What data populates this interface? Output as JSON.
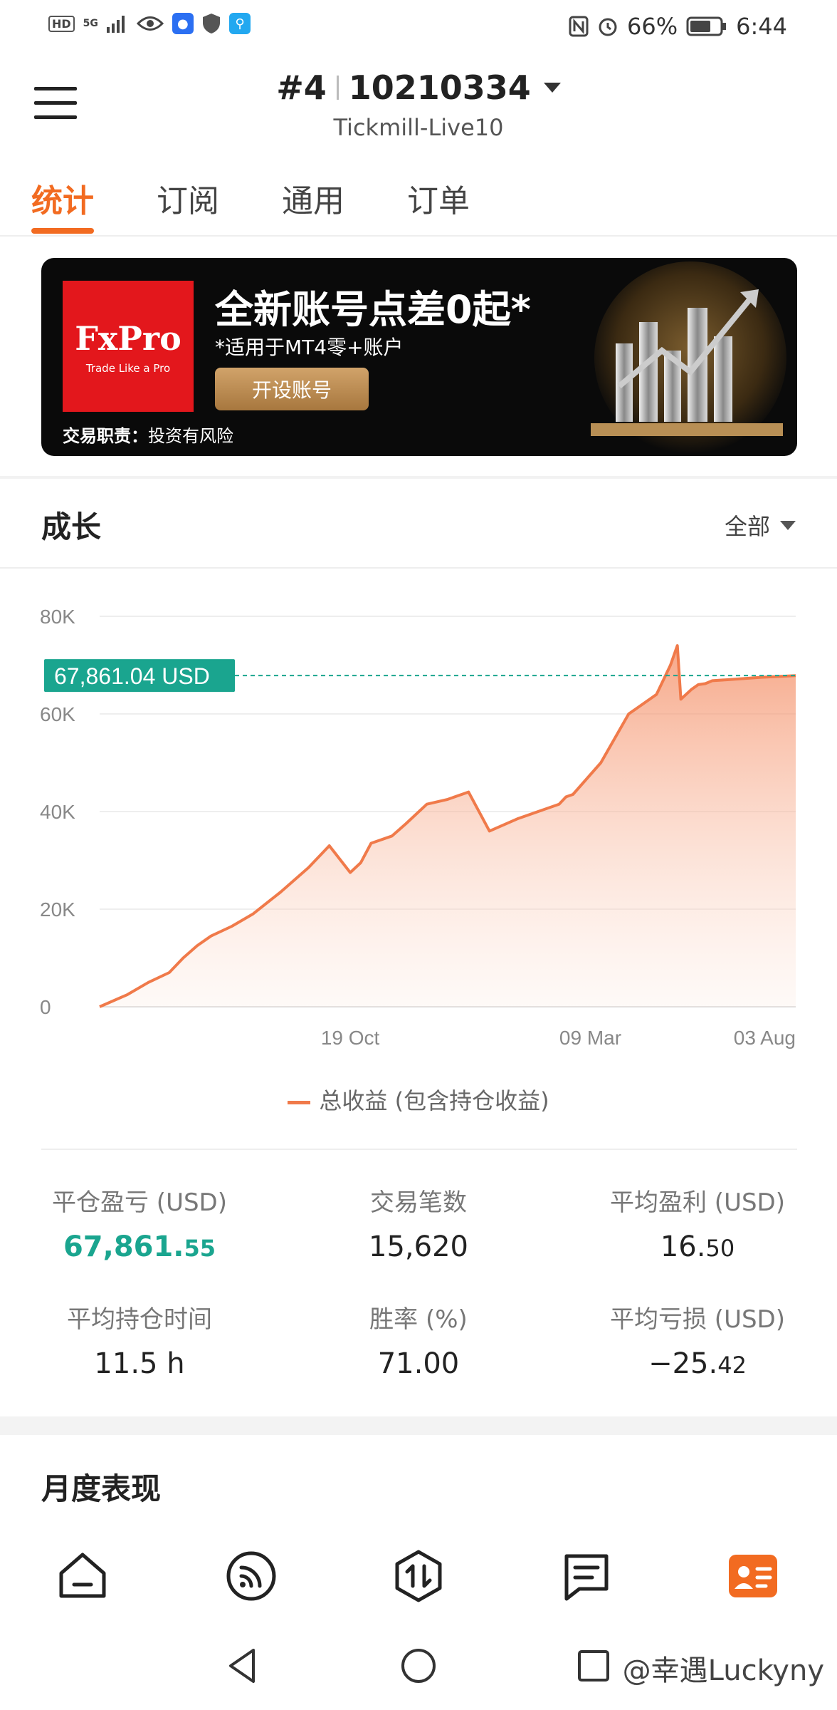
{
  "status_bar": {
    "hd": "HD",
    "net": "5G",
    "battery": "66%",
    "time": "6:44"
  },
  "header": {
    "account_index": "#4",
    "account_number": "10210334",
    "server": "Tickmill-Live10"
  },
  "tabs": [
    {
      "label": "统计",
      "active": true
    },
    {
      "label": "订阅",
      "active": false
    },
    {
      "label": "通用",
      "active": false
    },
    {
      "label": "订单",
      "active": false
    }
  ],
  "banner": {
    "logo": "FxPro",
    "logo_tagline": "Trade Like a Pro",
    "title": "全新账号点差0起*",
    "subtitle": "*适用于MT4零+账户",
    "button": "开设账号",
    "risk_label": "交易职责：",
    "risk_text": "投资有风险"
  },
  "growth": {
    "title": "成长",
    "range": "全部",
    "current_value_tag": "67,861.04 USD",
    "legend": "总收益 (包含持仓收益)"
  },
  "chart_data": {
    "type": "area",
    "title": "",
    "xlabel": "",
    "ylabel": "",
    "ylim": [
      0,
      80000
    ],
    "y_ticks": [
      "0",
      "20K",
      "40K",
      "60K",
      "80K"
    ],
    "x_ticks": [
      "19 Oct",
      "09 Mar",
      "03 Aug"
    ],
    "line_color": "#f07a4a",
    "reference_color": "#1aa58f",
    "reference_value": 67861.04,
    "series": [
      {
        "x": [
          0,
          0.04,
          0.07,
          0.1,
          0.12,
          0.14,
          0.16,
          0.19,
          0.22,
          0.26,
          0.3,
          0.33,
          0.36,
          0.375,
          0.39,
          0.42,
          0.44,
          0.47,
          0.5,
          0.53,
          0.56,
          0.6,
          0.63,
          0.66,
          0.67,
          0.68,
          0.72,
          0.76,
          0.8,
          0.82,
          0.83,
          0.835,
          0.85,
          0.86,
          0.87,
          0.875,
          0.88,
          0.9,
          0.95,
          1.0
        ],
        "values": [
          0,
          2500,
          5000,
          7000,
          10000,
          12500,
          14500,
          16500,
          19000,
          23500,
          28500,
          33000,
          27500,
          29500,
          33500,
          35000,
          37500,
          41500,
          42500,
          44000,
          36000,
          38500,
          40000,
          41500,
          43000,
          43500,
          50000,
          60000,
          64000,
          70000,
          74000,
          63000,
          65000,
          66000,
          66200,
          66500,
          66800,
          67000,
          67500,
          67861.04
        ]
      }
    ]
  },
  "stats": [
    {
      "label": "平仓盈亏 (USD)",
      "int": "67,861.",
      "dec": "55",
      "green": true
    },
    {
      "label": "交易笔数",
      "int": "15,620",
      "dec": "",
      "green": false
    },
    {
      "label": "平均盈利 (USD)",
      "int": "16.",
      "dec": "50",
      "green": false
    },
    {
      "label": "平均持仓时间",
      "int": "11.5 h",
      "dec": "",
      "green": false
    },
    {
      "label": "胜率 (%)",
      "int": "71.00",
      "dec": "",
      "green": false
    },
    {
      "label": "平均亏损 (USD)",
      "int": "−25.",
      "dec": "42",
      "green": false
    }
  ],
  "monthly": {
    "title": "月度表现"
  },
  "bottom_nav": [
    {
      "icon": "home-icon"
    },
    {
      "icon": "signal-icon"
    },
    {
      "icon": "trade-icon"
    },
    {
      "icon": "news-icon"
    },
    {
      "icon": "profile-icon",
      "active": true
    }
  ],
  "watermark": "@幸遇Luckyny"
}
